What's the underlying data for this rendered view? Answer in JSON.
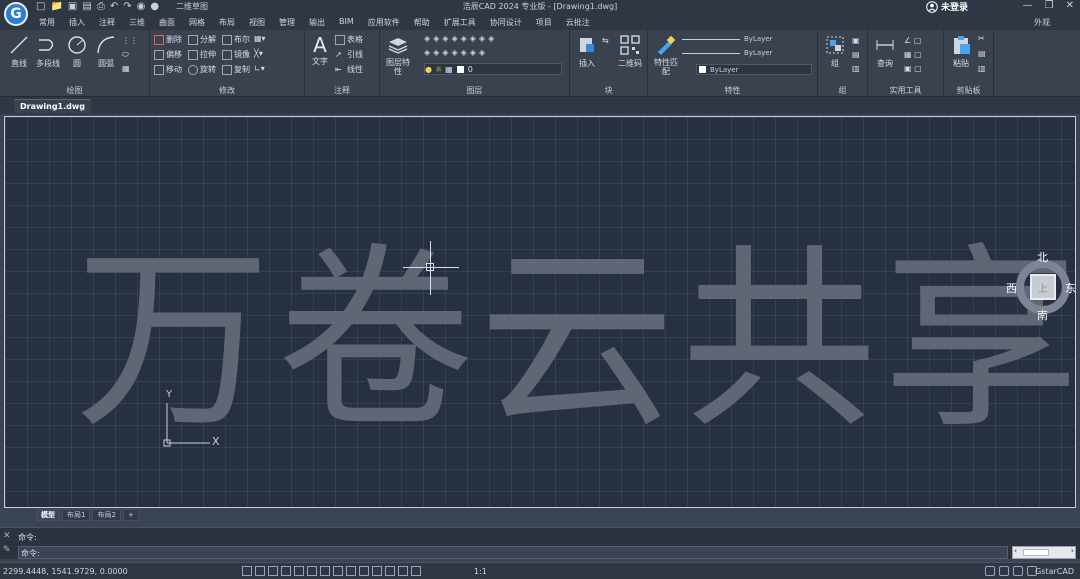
{
  "app": {
    "logo_letter": "G",
    "title": "浩辰CAD 2024 专业版 - [Drawing1.dwg]",
    "workspace": "二维草图",
    "login": "未登录",
    "appearance": "外观"
  },
  "menu": [
    "常用",
    "插入",
    "注释",
    "三维",
    "曲面",
    "网格",
    "布局",
    "视图",
    "管理",
    "输出",
    "BIM",
    "应用软件",
    "帮助",
    "扩展工具",
    "协同设计",
    "项目",
    "云批注"
  ],
  "ribbon": {
    "draw": {
      "label": "绘图",
      "tools": [
        "直线",
        "多段线",
        "圆",
        "圆弧"
      ]
    },
    "modify": {
      "label": "修改",
      "tools": [
        "删除",
        "分解",
        "布尔",
        "偏移",
        "拉伸",
        "镜像",
        "移动",
        "旋转",
        "复制"
      ]
    },
    "annotate": {
      "label": "注释",
      "tools": [
        "文字",
        "表格",
        "引线",
        "线性"
      ]
    },
    "layers": {
      "label": "图层",
      "tools": [
        "图层特性"
      ],
      "current_layer": "0"
    },
    "block": {
      "label": "块",
      "tools": [
        "插入",
        "二维码"
      ]
    },
    "properties": {
      "label": "特性",
      "tools": [
        "特性匹配"
      ],
      "bylayer_1": "ByLayer",
      "bylayer_2": "ByLayer",
      "bylayer_3": "ByLayer"
    },
    "group": {
      "label": "组",
      "tools": [
        "组"
      ]
    },
    "utilities": {
      "label": "实用工具",
      "tools": [
        "查询"
      ]
    },
    "clipboard": {
      "label": "剪贴板",
      "tools": [
        "粘贴"
      ]
    }
  },
  "document_tab": "Drawing1.dwg",
  "canvas": {
    "text": "万卷云共享",
    "ucs_y": "Y",
    "ucs_x": "X"
  },
  "viewcube": {
    "north": "北",
    "south": "南",
    "east": "东",
    "west": "西",
    "top": "上"
  },
  "layout_tabs": [
    "模型",
    "布局1",
    "布局2",
    "+"
  ],
  "command": {
    "line1": "命令:",
    "line2": "命令:"
  },
  "status": {
    "coords": "2299.4448, 1541.9729, 0.0000",
    "scale": "1:1",
    "brand": "GstarCAD"
  },
  "colors": {
    "accent": "#2a7fd4",
    "canvas": "#263040",
    "ribbon": "#3a4250",
    "text_on_canvas": "#5f6774"
  }
}
